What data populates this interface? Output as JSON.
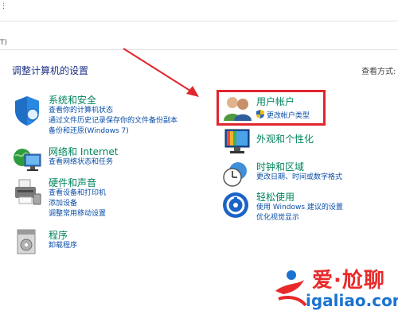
{
  "window": {
    "fragment_top": "⋮",
    "fragment_addr": "T)"
  },
  "header": {
    "title": "调整计算机的设置",
    "view_by": "查看方式:"
  },
  "left": [
    {
      "title": "系统和安全",
      "links": [
        "查看你的计算机状态",
        "通过文件历史记录保存你的文件备份副本",
        "备份和还原(Windows 7)"
      ]
    },
    {
      "title": "网络和 Internet",
      "links": [
        "查看网络状态和任务"
      ]
    },
    {
      "title": "硬件和声音",
      "links": [
        "查看设备和打印机",
        "添加设备",
        "调整常用移动设置"
      ]
    },
    {
      "title": "程序",
      "links": [
        "卸载程序"
      ]
    }
  ],
  "right": [
    {
      "title": "用户帐户",
      "links": [
        "更改帐户类型"
      ]
    },
    {
      "title": "外观和个性化",
      "links": []
    },
    {
      "title": "时钟和区域",
      "links": [
        "更改日期、时间或数字格式"
      ]
    },
    {
      "title": "轻松使用",
      "links": [
        "使用 Windows 建议的设置",
        "优化视觉显示"
      ]
    }
  ],
  "watermark": {
    "line1": "爱·尬聊",
    "line2": "igaliao.com"
  },
  "colors": {
    "highlight": "#e0262f",
    "link": "#0a4ea8",
    "category_title": "#00845d"
  }
}
